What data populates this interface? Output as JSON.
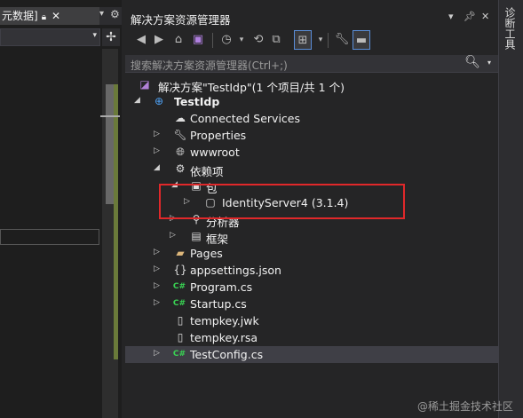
{
  "left_editor": {
    "tab_label": "元数据]",
    "lock_icon": "lock-icon",
    "close_glyph": "✕",
    "gear_icon": "gear-icon"
  },
  "solution_explorer": {
    "title": "解决方案资源管理器",
    "search_placeholder": "搜索解决方案资源管理器(Ctrl+;)",
    "tree": [
      {
        "label": "解决方案\"TestIdp\"(1 个项目/共 1 个)",
        "icon": "solution-icon",
        "level": 0,
        "expander": ""
      },
      {
        "label": "TestIdp",
        "icon": "web-project-icon",
        "level": 0,
        "expander": "expanded",
        "bold": true
      },
      {
        "label": "Connected Services",
        "icon": "connected-services-icon",
        "level": 1,
        "expander": ""
      },
      {
        "label": "Properties",
        "icon": "wrench-icon",
        "level": 1,
        "expander": "collapsed"
      },
      {
        "label": "wwwroot",
        "icon": "globe-icon",
        "level": 1,
        "expander": "collapsed"
      },
      {
        "label": "依赖项",
        "icon": "dependencies-icon",
        "level": 1,
        "expander": "expanded"
      },
      {
        "label": "包",
        "icon": "package-icon",
        "level": 2,
        "expander": "expanded"
      },
      {
        "label": "IdentityServer4 (3.1.4)",
        "icon": "nuget-package-icon",
        "level": 3,
        "expander": "collapsed"
      },
      {
        "label": "分析器",
        "icon": "analyzer-icon",
        "level": 2,
        "expander": "collapsed"
      },
      {
        "label": "框架",
        "icon": "framework-icon",
        "level": 2,
        "expander": "collapsed"
      },
      {
        "label": "Pages",
        "icon": "folder-icon",
        "level": 1,
        "expander": "collapsed"
      },
      {
        "label": "appsettings.json",
        "icon": "json-file-icon",
        "level": 1,
        "expander": "collapsed"
      },
      {
        "label": "Program.cs",
        "icon": "csharp-file-icon",
        "level": 1,
        "expander": "collapsed"
      },
      {
        "label": "Startup.cs",
        "icon": "csharp-file-icon",
        "level": 1,
        "expander": "collapsed"
      },
      {
        "label": "tempkey.jwk",
        "icon": "file-icon",
        "level": 1,
        "expander": ""
      },
      {
        "label": "tempkey.rsa",
        "icon": "file-icon",
        "level": 1,
        "expander": ""
      },
      {
        "label": "TestConfig.cs",
        "icon": "csharp-file-icon",
        "level": 1,
        "expander": "collapsed",
        "selected": true
      }
    ],
    "cs_badge": "C#"
  },
  "right_strip": {
    "label": "诊断工具"
  },
  "watermark": "@稀土掘金技术社区",
  "colors": {
    "highlight_box": "#e0282a",
    "csharp_badge": "#39d353",
    "panel_bg": "#252526"
  }
}
